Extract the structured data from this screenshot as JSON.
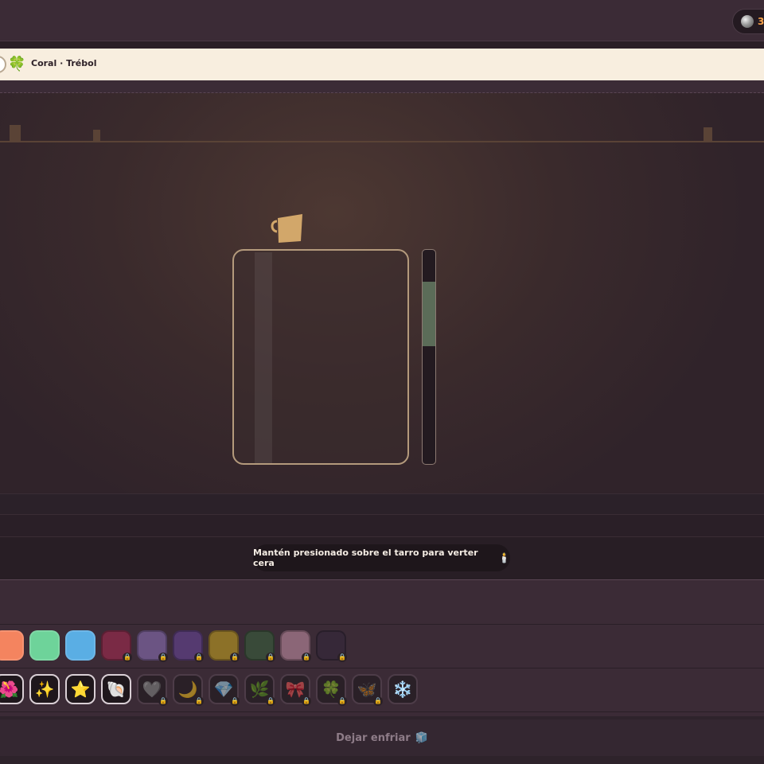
{
  "header": {
    "coins": "3"
  },
  "info": {
    "label": "Coral · Trébol"
  },
  "hint": {
    "text": "Mantén presionado sobre el tarro para verter cera",
    "icon": "🕯️"
  },
  "fill_meter": {
    "target_start": 0.15,
    "target_end": 0.45,
    "level": 0
  },
  "colors": [
    {
      "name": "coral",
      "hex": "#f4845f",
      "locked": false
    },
    {
      "name": "green",
      "hex": "#6ed39a",
      "locked": false
    },
    {
      "name": "blue",
      "hex": "#5aaee4",
      "locked": false
    },
    {
      "name": "wine",
      "hex": "#7a2a45",
      "locked": true
    },
    {
      "name": "lavender",
      "hex": "#6b5483",
      "locked": true
    },
    {
      "name": "purple",
      "hex": "#553a70",
      "locked": true
    },
    {
      "name": "mustard",
      "hex": "#8c7128",
      "locked": true
    },
    {
      "name": "forest",
      "hex": "#394a39",
      "locked": true
    },
    {
      "name": "mauve",
      "hex": "#8b6677",
      "locked": true
    },
    {
      "name": "plum",
      "hex": "#362838",
      "locked": true
    }
  ],
  "charms": [
    {
      "name": "flowers",
      "glyph": "🌺",
      "locked": false,
      "active": true
    },
    {
      "name": "sparkles",
      "glyph": "✨",
      "locked": false,
      "active": true
    },
    {
      "name": "star",
      "glyph": "⭐",
      "locked": false,
      "active": true
    },
    {
      "name": "shell",
      "glyph": "🐚",
      "locked": false,
      "active": true
    },
    {
      "name": "heart",
      "glyph": "🩶",
      "locked": true,
      "active": false
    },
    {
      "name": "moon",
      "glyph": "🌙",
      "locked": true,
      "active": false
    },
    {
      "name": "gem",
      "glyph": "💎",
      "locked": true,
      "active": false
    },
    {
      "name": "herb",
      "glyph": "🌿",
      "locked": true,
      "active": false
    },
    {
      "name": "ribbon",
      "glyph": "🎀",
      "locked": true,
      "active": false
    },
    {
      "name": "clover",
      "glyph": "🍀",
      "locked": true,
      "active": false
    },
    {
      "name": "butterfly",
      "glyph": "🦋",
      "locked": true,
      "active": false
    },
    {
      "name": "snowflake",
      "glyph": "❄️",
      "locked": false,
      "active": false
    }
  ],
  "action": {
    "label": "Dejar enfriar",
    "icon": "🧊"
  }
}
